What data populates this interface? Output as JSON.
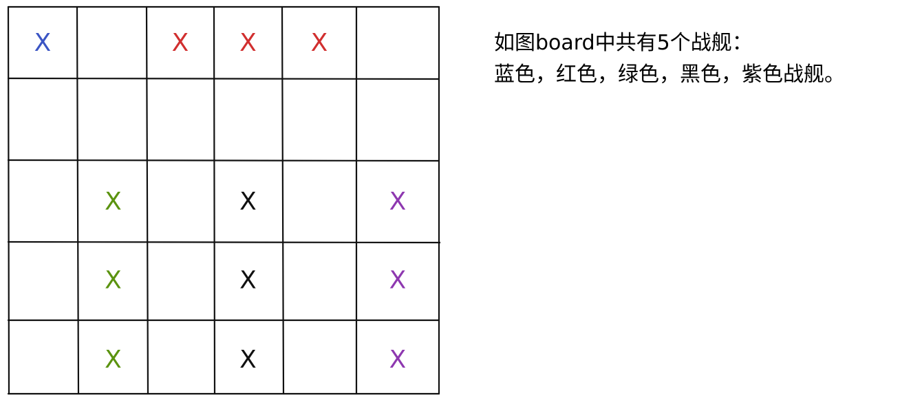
{
  "board": {
    "rows": 5,
    "cols": 6,
    "mark": "X",
    "marks": [
      {
        "row": 0,
        "col": 0,
        "color": "blue"
      },
      {
        "row": 0,
        "col": 2,
        "color": "red"
      },
      {
        "row": 0,
        "col": 3,
        "color": "red"
      },
      {
        "row": 0,
        "col": 4,
        "color": "red"
      },
      {
        "row": 2,
        "col": 1,
        "color": "green"
      },
      {
        "row": 2,
        "col": 3,
        "color": "black"
      },
      {
        "row": 2,
        "col": 5,
        "color": "purple"
      },
      {
        "row": 3,
        "col": 1,
        "color": "green"
      },
      {
        "row": 3,
        "col": 3,
        "color": "black"
      },
      {
        "row": 3,
        "col": 5,
        "color": "purple"
      },
      {
        "row": 4,
        "col": 1,
        "color": "green"
      },
      {
        "row": 4,
        "col": 3,
        "color": "black"
      },
      {
        "row": 4,
        "col": 5,
        "color": "purple"
      }
    ]
  },
  "colors": {
    "blue": "#3b55c4",
    "red": "#d12f2f",
    "green": "#5b9310",
    "black": "#111111",
    "purple": "#8e38b0",
    "grid": "#111111"
  },
  "caption": {
    "line1": "如图board中共有5个战舰：",
    "line2": "蓝色，红色，绿色，黑色，紫色战舰。"
  }
}
